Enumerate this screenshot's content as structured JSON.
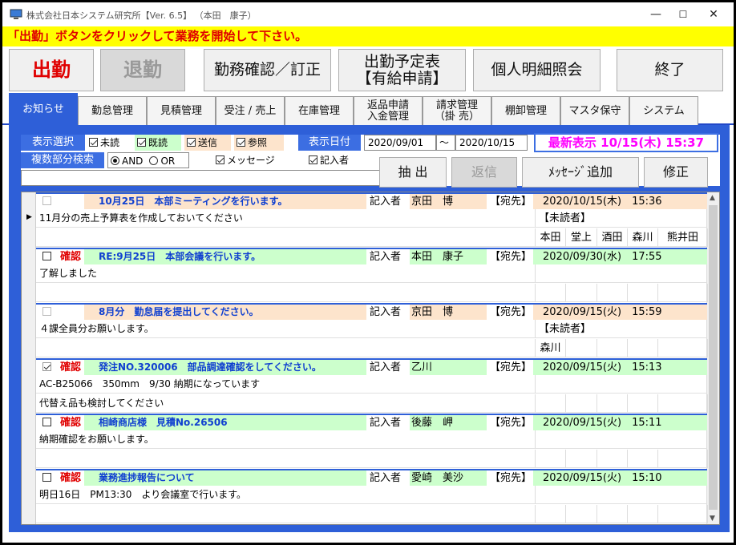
{
  "window": {
    "title": "株式会社日本システム研究所【Ver. 6.5】  （本田　康子）",
    "min": "—",
    "max": "☐",
    "close": "✕"
  },
  "banner": "「出勤」ボタンをクリックして業務を開始して下さい。",
  "buttons": {
    "attend": "出勤",
    "leave": "退勤",
    "work_confirm": "勤務確認／訂正",
    "schedule_l1": "出勤予定表",
    "schedule_l2": "【有給申請】",
    "personal": "個人明細照会",
    "exit": "終了"
  },
  "tabs": [
    {
      "label": "お知らせ"
    },
    {
      "label": "勤怠管理"
    },
    {
      "label": "見積管理"
    },
    {
      "label": "受注 / 売上"
    },
    {
      "label": "在庫管理"
    },
    {
      "label": "返品申請\n入金管理"
    },
    {
      "label": "請求管理\n（掛 売）"
    },
    {
      "label": "棚卸管理"
    },
    {
      "label": "マスタ保守"
    },
    {
      "label": "システム"
    }
  ],
  "filter": {
    "display_select": "表示選択",
    "unread": "未読",
    "read": "既読",
    "sent": "送信",
    "ref": "参照",
    "display_date": "表示日付",
    "date_from": "2020/09/01",
    "tilde": "〜",
    "date_to": "2020/10/15",
    "latest": "最新表示 10/15(木) 15:37",
    "multi_search": "複数部分検索",
    "and": "AND",
    "or": "OR",
    "message": "メッセージ",
    "writer": "記入者",
    "extract": "抽 出",
    "reply": "返信",
    "add_message": "ﾒｯｾｰｼﾞ追加",
    "edit": "修正"
  },
  "records": [
    {
      "confirm": "",
      "subject": "10月25日　本部ミーティングを行います。",
      "writer_lbl": "記入者",
      "writer": "京田　博",
      "to": "【宛先】",
      "datetime": "2020/10/15(木)　15:36",
      "color": "#fde4cc",
      "lines": [
        "11月分の売上予算表を作成しておいてください",
        ""
      ],
      "unread_lbl": "【未読者】",
      "unread": [
        "本田",
        "堂上",
        "酒田",
        "森川",
        "熊井田"
      ]
    },
    {
      "confirm": "確認",
      "subject": "RE:9月25日　本部会議を行います。",
      "writer_lbl": "記入者",
      "writer": "本田　康子",
      "to": "【宛先】",
      "datetime": "2020/09/30(水)　17:55",
      "color": "#ccffcc",
      "lines": [
        "了解しました",
        ""
      ],
      "unread_lbl": "",
      "unread": [
        "",
        "",
        "",
        "",
        ""
      ]
    },
    {
      "confirm": "",
      "subject": "8月分　勤怠届を提出してください。",
      "writer_lbl": "記入者",
      "writer": "京田　博",
      "to": "【宛先】",
      "datetime": "2020/09/15(火)　15:59",
      "color": "#fde4cc",
      "lines": [
        "４課全員分お願いします。",
        ""
      ],
      "unread_lbl": "【未読者】",
      "unread": [
        "森川",
        "",
        "",
        "",
        ""
      ]
    },
    {
      "confirm": "確認",
      "subject": "発注NO.320006　部品調達確認をしてください。",
      "writer_lbl": "記入者",
      "writer": "乙川",
      "to": "【宛先】",
      "datetime": "2020/09/15(火)　15:13",
      "color": "#ccffcc",
      "lines": [
        "AC-B25066　350mm　9/30 納期になっています",
        "代替え品も検討してください"
      ],
      "unread_lbl": "",
      "unread": [
        "",
        "",
        "",
        "",
        ""
      ]
    },
    {
      "confirm": "確認",
      "subject": "相崎商店様　見積No.26506",
      "writer_lbl": "記入者",
      "writer": "後藤　岬",
      "to": "【宛先】",
      "datetime": "2020/09/15(火)　15:11",
      "color": "#ccffcc",
      "lines": [
        "納期確認をお願いします。",
        ""
      ],
      "unread_lbl": "",
      "unread": [
        "",
        "",
        "",
        "",
        ""
      ]
    },
    {
      "confirm": "確認",
      "subject": "業務進捗報告について",
      "writer_lbl": "記入者",
      "writer": "愛崎　美沙",
      "to": "【宛先】",
      "datetime": "2020/09/15(火)　15:10",
      "color": "#ccffcc",
      "lines": [
        "明日16日　PM13:30　より会議室で行います。",
        ""
      ],
      "unread_lbl": "",
      "unread": [
        "",
        "",
        "",
        "",
        ""
      ]
    }
  ]
}
